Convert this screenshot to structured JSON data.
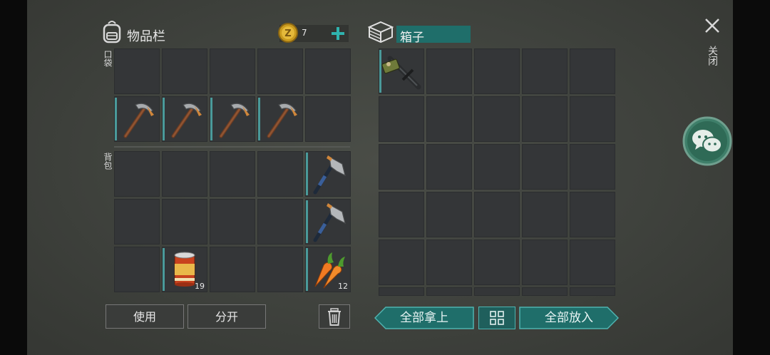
{
  "inventory": {
    "title": "物品栏",
    "icon": "backpack-icon",
    "coin_count": "7",
    "coin_icon": "gold-coin-icon",
    "pocket_label": "口袋",
    "backpack_label": "背包",
    "pocket_items": [
      {
        "slot": 5,
        "item": "pickaxe",
        "icon": "pickaxe-icon"
      },
      {
        "slot": 6,
        "item": "pickaxe",
        "icon": "pickaxe-icon"
      },
      {
        "slot": 7,
        "item": "pickaxe",
        "icon": "pickaxe-icon"
      },
      {
        "slot": 8,
        "item": "pickaxe",
        "icon": "pickaxe-icon"
      }
    ],
    "backpack_items": [
      {
        "slot": 4,
        "item": "hatchet",
        "icon": "hatchet-icon"
      },
      {
        "slot": 9,
        "item": "hatchet",
        "icon": "hatchet-icon"
      },
      {
        "slot": 11,
        "item": "canned food",
        "icon": "canned-food-icon",
        "qty": "19"
      },
      {
        "slot": 14,
        "item": "carrot",
        "icon": "carrot-icon",
        "qty": "12"
      }
    ],
    "use_label": "使用",
    "split_label": "分开",
    "trash_icon": "trash-icon"
  },
  "box": {
    "title": "箱子",
    "icon": "box-icon",
    "items": [
      {
        "slot": 0,
        "item": "crossbow",
        "icon": "crossbow-icon"
      }
    ],
    "take_all_label": "全部拿上",
    "sort_icon": "grid-sort-icon",
    "put_all_label": "全部放入"
  },
  "close_label": "关闭",
  "chat_icon": "wechat-icon",
  "colors": {
    "accent": "#1f6e6a",
    "accent_border": "#4fb3b0",
    "slot": "#343638"
  }
}
